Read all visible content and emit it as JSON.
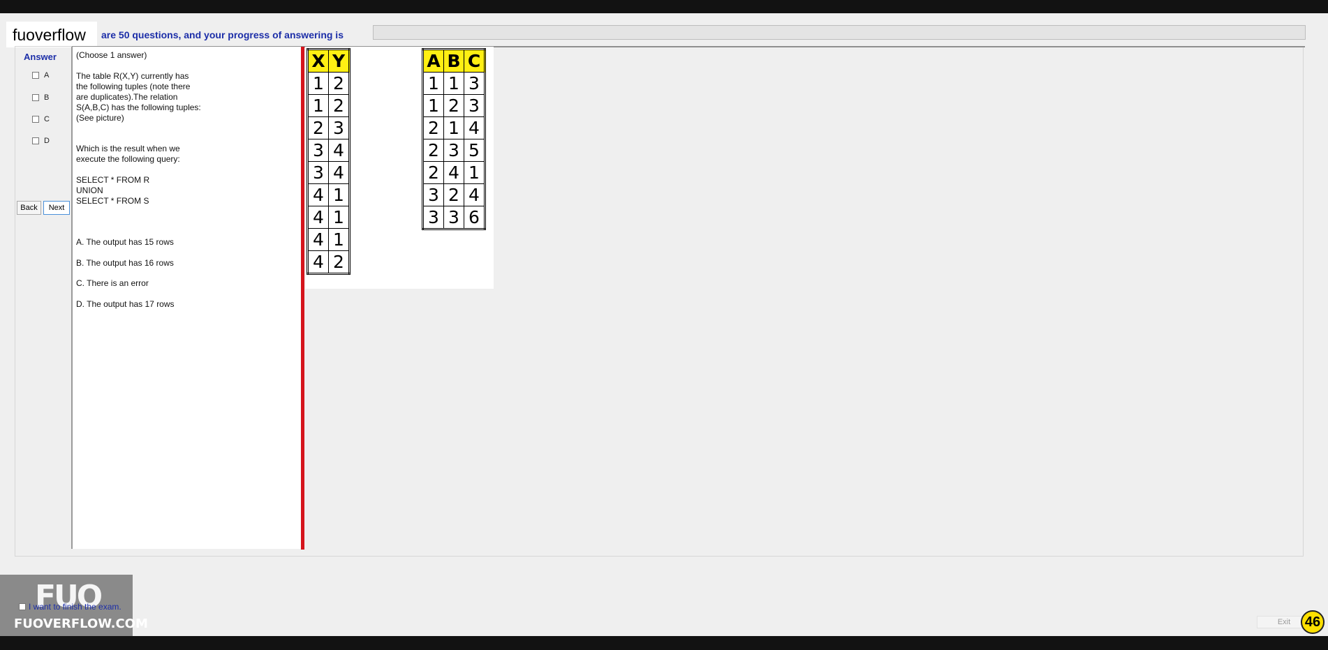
{
  "header": {
    "brand": "fuoverflow",
    "progress_text": "are 50 questions, and your progress of answering is",
    "progress_fraction": 0
  },
  "answer_panel": {
    "title": "Answer",
    "options": [
      "A",
      "B",
      "C",
      "D"
    ],
    "back_label": "Back",
    "next_label": "Next"
  },
  "question": {
    "instruction": "(Choose 1 answer)",
    "body_lines": [
      "The table R(X,Y) currently has",
      "the following tuples (note there",
      "are duplicates).The relation",
      "S(A,B,C) has the following tuples:",
      "(See picture)"
    ],
    "prompt_lines": [
      "Which is the result when we",
      "execute the following query:"
    ],
    "query_lines": [
      "SELECT * FROM R",
      "UNION",
      "SELECT * FROM S"
    ],
    "choices": [
      "A.  The output has 15 rows",
      "B.  The output has 16 rows",
      "C.  There is an error",
      "D.  The output has 17 rows"
    ]
  },
  "table_r": {
    "headers": [
      "X",
      "Y"
    ],
    "rows": [
      [
        "1",
        "2"
      ],
      [
        "1",
        "2"
      ],
      [
        "2",
        "3"
      ],
      [
        "3",
        "4"
      ],
      [
        "3",
        "4"
      ],
      [
        "4",
        "1"
      ],
      [
        "4",
        "1"
      ],
      [
        "4",
        "1"
      ],
      [
        "4",
        "2"
      ]
    ]
  },
  "table_s": {
    "headers": [
      "A",
      "B",
      "C"
    ],
    "rows": [
      [
        "1",
        "1",
        "3"
      ],
      [
        "1",
        "2",
        "3"
      ],
      [
        "2",
        "1",
        "4"
      ],
      [
        "2",
        "3",
        "5"
      ],
      [
        "2",
        "4",
        "1"
      ],
      [
        "3",
        "2",
        "4"
      ],
      [
        "3",
        "3",
        "6"
      ]
    ]
  },
  "footer": {
    "logo_mark": "FUO",
    "logo_text": "FUOVERFLOW.COM",
    "finish_label": "I want to finish the exam.",
    "exit_label": "Exit",
    "question_number": "46"
  },
  "colors": {
    "accent_blue": "#1c2ea8",
    "divider_red": "#d5141c",
    "table_header_yellow": "#ffef13",
    "badge_yellow": "#ffe000"
  }
}
